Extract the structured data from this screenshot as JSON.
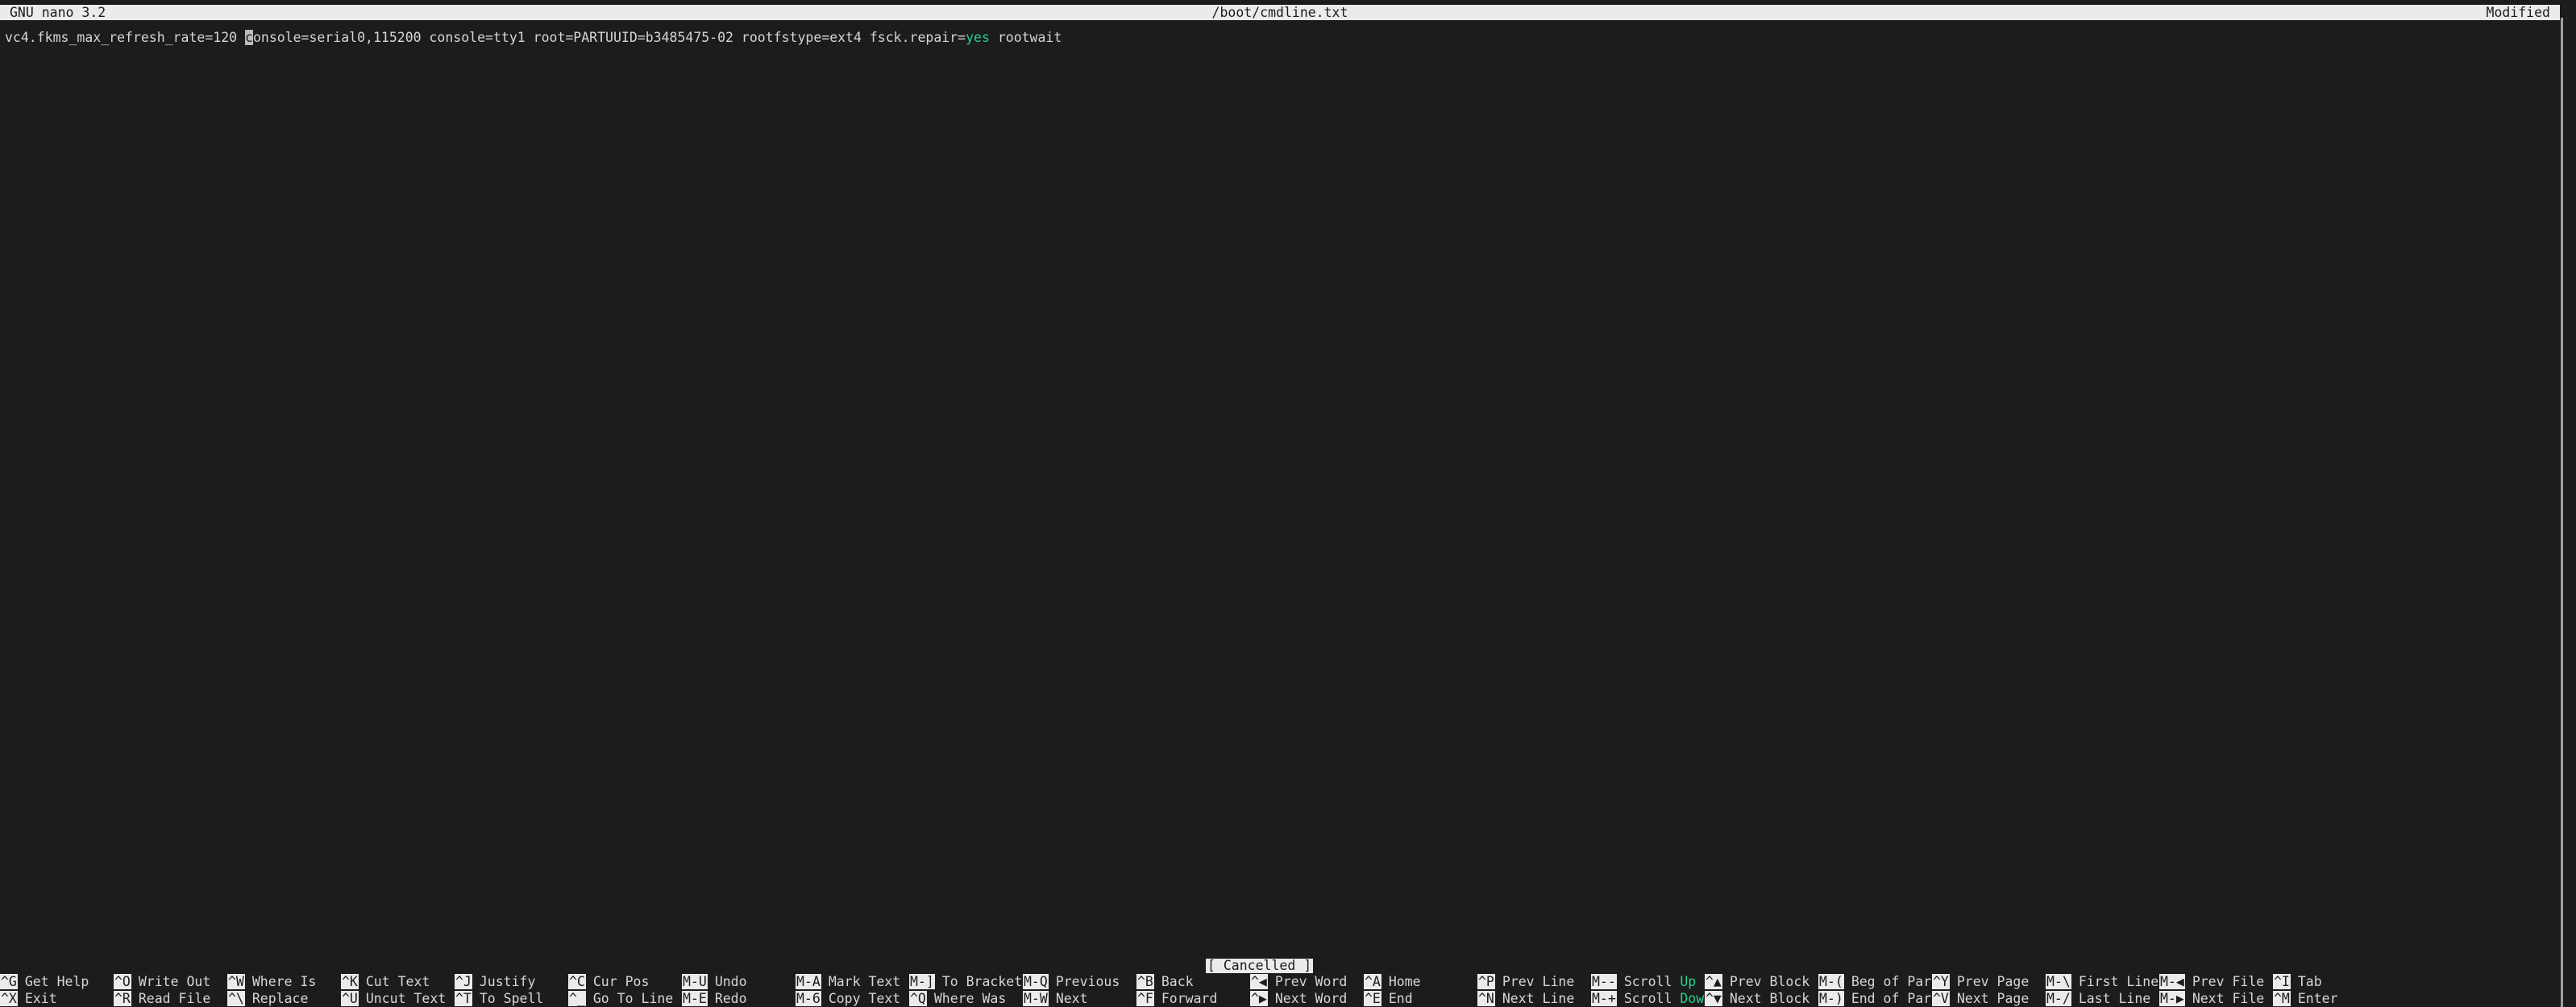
{
  "titlebar": {
    "version": "GNU nano 3.2",
    "filename": "/boot/cmdline.txt",
    "state": "Modified"
  },
  "editor": {
    "line_before_cursor": "vc4.fkms_max_refresh_rate=120 ",
    "cursor_char": "c",
    "line_after_cursor": "onsole=serial0,115200 console=tty1 root=PARTUUID=b3485475-02 rootfstype=ext4 fsck.repair=",
    "match_text": "yes",
    "line_tail": " rootwait",
    "full_line": "vc4.fkms_max_refresh_rate=120 console=serial0,115200 console=tty1 root=PARTUUID=b3485475-02 rootfstype=ext4 fsck.repair=yes rootwait"
  },
  "status": {
    "message": "[ Cancelled ]"
  },
  "colors": {
    "background": "#1c1c1c",
    "foreground": "#d6d6d6",
    "inverse_bg": "#ebebeb",
    "inverse_fg": "#1c1c1c",
    "green": "#23d18b",
    "cursor": "#bcbcbc"
  },
  "shortcuts": [
    {
      "top": {
        "key": "^G",
        "label": "Get Help"
      },
      "bottom": {
        "key": "^X",
        "label": "Exit"
      }
    },
    {
      "top": {
        "key": "^O",
        "label": "Write Out"
      },
      "bottom": {
        "key": "^R",
        "label": "Read File"
      }
    },
    {
      "top": {
        "key": "^W",
        "label": "Where Is"
      },
      "bottom": {
        "key": "^\\",
        "label": "Replace"
      }
    },
    {
      "top": {
        "key": "^K",
        "label": "Cut Text"
      },
      "bottom": {
        "key": "^U",
        "label": "Uncut Text"
      }
    },
    {
      "top": {
        "key": "^J",
        "label": "Justify"
      },
      "bottom": {
        "key": "^T",
        "label": "To Spell"
      }
    },
    {
      "top": {
        "key": "^C",
        "label": "Cur Pos"
      },
      "bottom": {
        "key": "^_",
        "label": "Go To Line"
      }
    },
    {
      "top": {
        "key": "M-U",
        "label": "Undo"
      },
      "bottom": {
        "key": "M-E",
        "label": "Redo"
      }
    },
    {
      "top": {
        "key": "M-A",
        "label": "Mark Text"
      },
      "bottom": {
        "key": "M-6",
        "label": "Copy Text"
      }
    },
    {
      "top": {
        "key": "M-]",
        "label": "To Bracket"
      },
      "bottom": {
        "key": "^Q",
        "label": "Where Was"
      }
    },
    {
      "top": {
        "key": "M-Q",
        "label": "Previous"
      },
      "bottom": {
        "key": "M-W",
        "label": "Next"
      }
    },
    {
      "top": {
        "key": "^B",
        "label": "Back"
      },
      "bottom": {
        "key": "^F",
        "label": "Forward"
      }
    },
    {
      "top": {
        "key": "^◀",
        "label": "Prev Word"
      },
      "bottom": {
        "key": "^▶",
        "label": "Next Word"
      }
    },
    {
      "top": {
        "key": "^A",
        "label": "Home"
      },
      "bottom": {
        "key": "^E",
        "label": "End"
      }
    },
    {
      "top": {
        "key": "^P",
        "label": "Prev Line"
      },
      "bottom": {
        "key": "^N",
        "label": "Next Line"
      }
    },
    {
      "top": {
        "key": "M--",
        "label": "Scroll ",
        "hl": "Up"
      },
      "bottom": {
        "key": "M-+",
        "label": "Scroll ",
        "hl": "Down"
      }
    },
    {
      "top": {
        "key": "^▲",
        "label": "Prev Block"
      },
      "bottom": {
        "key": "^▼",
        "label": "Next Block"
      }
    },
    {
      "top": {
        "key": "M-(",
        "label": "Beg of Par"
      },
      "bottom": {
        "key": "M-)",
        "label": "End of Par"
      }
    },
    {
      "top": {
        "key": "^Y",
        "label": "Prev Page"
      },
      "bottom": {
        "key": "^V",
        "label": "Next Page"
      }
    },
    {
      "top": {
        "key": "M-\\",
        "label": "First Line"
      },
      "bottom": {
        "key": "M-/",
        "label": "Last Line"
      }
    },
    {
      "top": {
        "key": "M-◀",
        "label": "Prev File"
      },
      "bottom": {
        "key": "M-▶",
        "label": "Next File"
      }
    },
    {
      "top": {
        "key": "^I",
        "label": "Tab"
      },
      "bottom": {
        "key": "^M",
        "label": "Enter"
      }
    }
  ]
}
